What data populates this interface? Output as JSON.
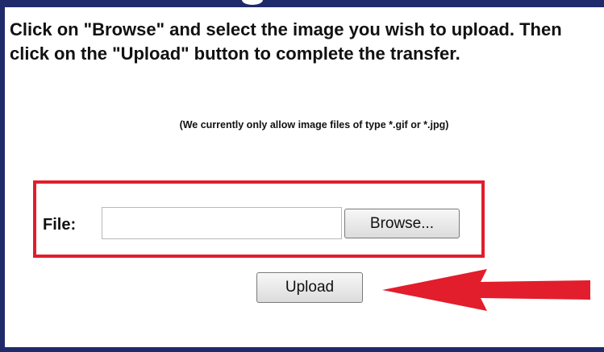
{
  "instructions": "Click on \"Browse\" and select the image you wish to upload. Then click on the \"Upload\" button to complete the transfer.",
  "note": "(We currently only allow image files of type *.gif or *.jpg)",
  "file_field": {
    "label": "File:",
    "value": "",
    "browse_label": "Browse..."
  },
  "upload_label": "Upload",
  "colors": {
    "frame": "#1f2a6b",
    "highlight": "#e21d2c"
  }
}
